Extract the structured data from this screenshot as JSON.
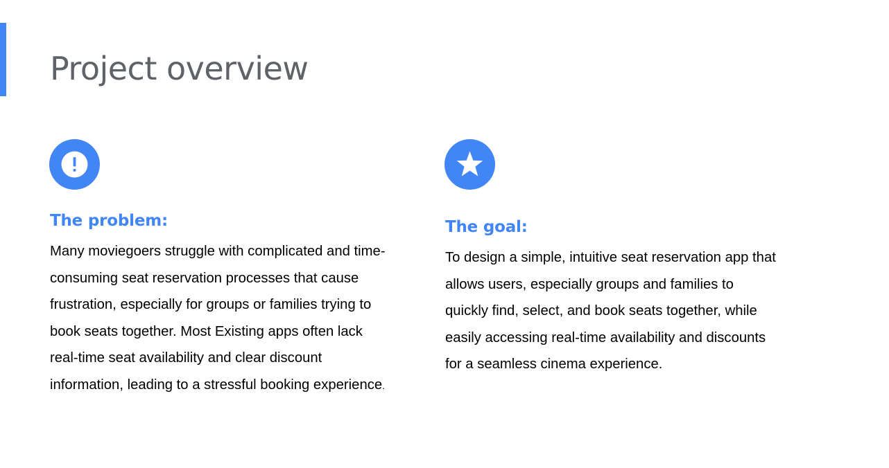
{
  "page": {
    "title": "Project overview",
    "accent_color": "#4285f4"
  },
  "problem": {
    "icon": "exclamation-icon",
    "heading": "The problem:",
    "body": "Many moviegoers struggle with complicated and time-consuming seat reservation processes that cause frustration, especially for groups or families trying to book seats together. Most Existing apps often lack real-time seat availability and clear discount information, leading to a stressful booking experience",
    "body_end": "."
  },
  "goal": {
    "icon": "star-icon",
    "heading": "The goal:",
    "body": "To design a simple, intuitive seat reservation app that allows users, especially groups and families to quickly find, select, and book seats together, while easily accessing real-time availability and discounts for a seamless cinema experience."
  }
}
